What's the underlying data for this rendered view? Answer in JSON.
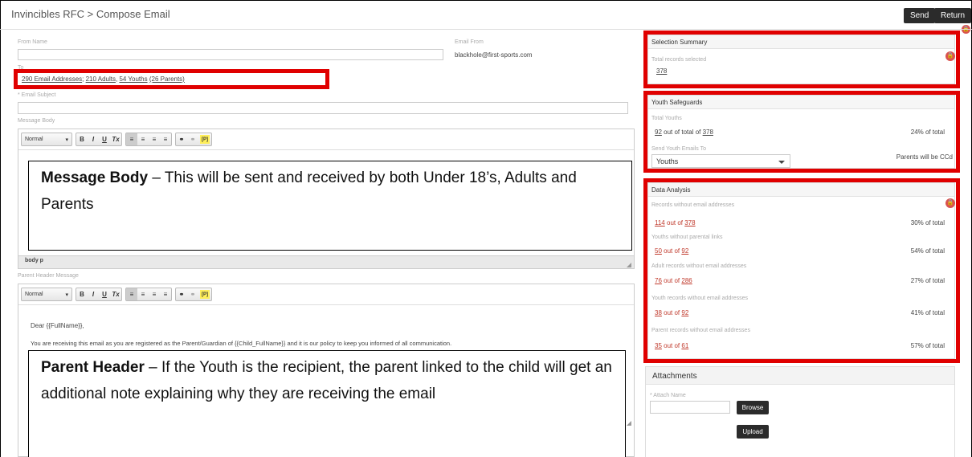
{
  "header": {
    "breadcrumb": "Invincibles RFC > Compose Email",
    "send_label": "Send",
    "return_label": "Return"
  },
  "compose": {
    "from_name_label": "From Name",
    "email_from_label": "Email From",
    "email_from_value": "blackhole@first-sports.com",
    "to_label": "To",
    "recipients": {
      "emails": "290 Email Addresses",
      "adults": "210 Adults",
      "youths": "54 Youths",
      "parents": "(26 Parents)"
    },
    "subject_label": "* Email Subject",
    "message_body_label": "Message Body",
    "parent_header_label": "Parent Header Message",
    "editor_status": "body  p",
    "toolbar": {
      "format": "Normal",
      "bold": "B",
      "italic": "I",
      "underline": "U",
      "clear": "Tx",
      "link": "⚭",
      "unlink": "⚭",
      "placeholder": "[P]"
    },
    "parent_header_line1": "Dear {{FullName}},",
    "parent_header_line2": "You are receiving this email as you are registered as the Parent/Guardian of {{Child_FullName}} and it is our policy to keep you informed of all communication."
  },
  "callouts": {
    "message_body": {
      "title": "Message Body",
      "text": " – This will be sent and received by both Under 18’s, Adults and Parents"
    },
    "parent_header": {
      "title": "Parent Header",
      "text": " – If the Youth is the recipient, the parent linked to the child will get an additional note explaining why they are receiving the email"
    }
  },
  "selection_summary": {
    "title": "Selection Summary",
    "label": "Total records selected",
    "value": "378"
  },
  "youth_safeguards": {
    "title": "Youth Safeguards",
    "total_label": "Total Youths",
    "count": "92",
    "out_of_text": " out of total of ",
    "total": "378",
    "percent": "24% of total",
    "send_to_label": "Send Youth Emails To",
    "send_to_value": "Youths",
    "cc_note": "Parents will be CCd"
  },
  "data_analysis": {
    "title": "Data Analysis",
    "out_of": " out of ",
    "rows": [
      {
        "label": "Records without email addresses",
        "count": "114",
        "total": "378",
        "percent": "30% of total"
      },
      {
        "label": "Youths without parental links",
        "count": "50",
        "total": "92",
        "percent": "54% of total"
      },
      {
        "label": "Adult records without email addresses",
        "count": "76",
        "total": "286",
        "percent": "27% of total"
      },
      {
        "label": "Youth records without email addresses",
        "count": "38",
        "total": "92",
        "percent": "41% of total"
      },
      {
        "label": "Parent records without email addresses",
        "count": "35",
        "total": "61",
        "percent": "57% of total"
      }
    ]
  },
  "attachments": {
    "title": "Attachments",
    "attach_name_label": "* Attach Name",
    "browse_label": "Browse",
    "upload_label": "Upload"
  },
  "colors": {
    "highlight": "#e00000",
    "button": "#2b2b2b",
    "link_red": "#c0392b"
  }
}
